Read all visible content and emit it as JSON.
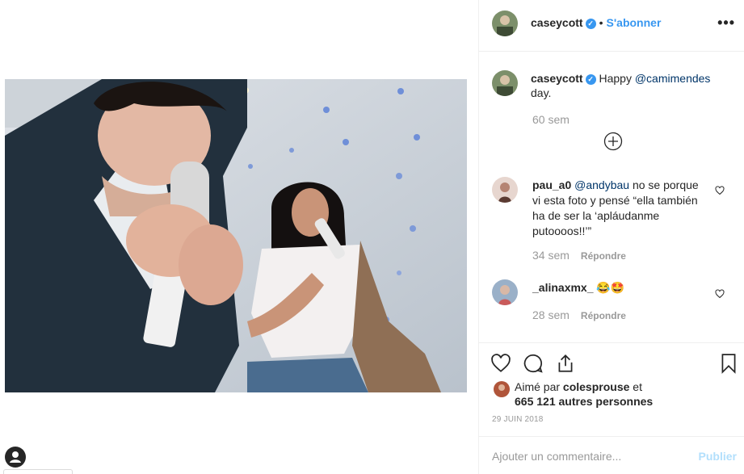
{
  "post": {
    "author": "caseycott",
    "follow_label": "S'abonner",
    "separator": "•",
    "more_icon": "more-options-icon",
    "caption_text": "Happy",
    "caption_mention": "@camimendes",
    "caption_rest": "day.",
    "caption_time": "60 sem",
    "load_more_icon": "plus-circle-icon"
  },
  "comments": [
    {
      "user": "pau_a0",
      "mention": "@andybau",
      "text_line1": "no se porque",
      "text_line2": "vi esta foto y pensé “ella también",
      "text_line3": "ha de ser la ‘apláudanme",
      "text_line4": "putoooos!!’”",
      "time": "34 sem",
      "reply_label": "Répondre"
    },
    {
      "user": "_alinaxmx_",
      "text": "😂🤩",
      "time": "28 sem",
      "reply_label": "Répondre"
    }
  ],
  "actions": {
    "like_icon": "heart-icon",
    "comment_icon": "comment-icon",
    "share_icon": "share-icon",
    "save_icon": "bookmark-icon"
  },
  "likes": {
    "prefix": "Aimé par",
    "user": "colesprouse",
    "joiner": "et",
    "count": "665 121 autres personnes"
  },
  "date": "29 JUIN 2018",
  "comment_box": {
    "placeholder": "Ajouter un commentaire...",
    "publish_label": "Publier"
  },
  "colors": {
    "link_blue": "#3897f0",
    "mention_blue": "#003569",
    "muted": "#999999",
    "border": "#efefef"
  }
}
